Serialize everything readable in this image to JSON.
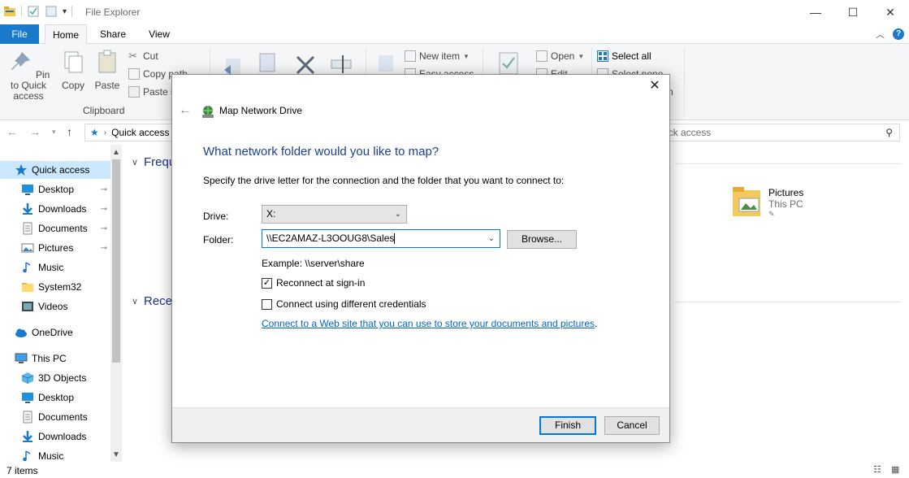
{
  "window": {
    "title": "File Explorer",
    "minimize_glyph": "—",
    "maximize_glyph": "☐",
    "close_glyph": "✕"
  },
  "ribbon_tabs": {
    "file": "File",
    "home": "Home",
    "share": "Share",
    "view": "View"
  },
  "ribbon": {
    "pin_label": "Pin to Quick access",
    "copy_label": "Copy",
    "paste_label": "Paste",
    "cut_label": "Cut",
    "copy_path_label": "Copy path",
    "paste_shortcut_label": "Paste s",
    "clipboard_group": "Clipboard",
    "new_item_label": "New item",
    "easy_access_label": "Easy access",
    "open_label": "Open",
    "edit_label": "Edit",
    "select_all_label": "Select all",
    "select_none_label": "Select none",
    "invert_label": "n"
  },
  "address": {
    "location": "Quick access",
    "search_placeholder": "ick access"
  },
  "navpane": {
    "items": [
      {
        "label": "Quick access",
        "icon": "star-icon",
        "pinned": false
      },
      {
        "label": "Desktop",
        "icon": "desktop-icon",
        "pinned": true
      },
      {
        "label": "Downloads",
        "icon": "download-icon",
        "pinned": true
      },
      {
        "label": "Documents",
        "icon": "document-icon",
        "pinned": true
      },
      {
        "label": "Pictures",
        "icon": "pictures-icon",
        "pinned": true
      },
      {
        "label": "Music",
        "icon": "music-icon",
        "pinned": false
      },
      {
        "label": "System32",
        "icon": "folder-icon",
        "pinned": false
      },
      {
        "label": "Videos",
        "icon": "video-icon",
        "pinned": false
      },
      {
        "label": "OneDrive",
        "icon": "cloud-icon",
        "pinned": false
      },
      {
        "label": "This PC",
        "icon": "computer-icon",
        "pinned": false
      },
      {
        "label": "3D Objects",
        "icon": "cube-icon",
        "pinned": false
      },
      {
        "label": "Desktop",
        "icon": "desktop-icon",
        "pinned": false
      },
      {
        "label": "Documents",
        "icon": "document-icon",
        "pinned": false
      },
      {
        "label": "Downloads",
        "icon": "download-icon",
        "pinned": false
      },
      {
        "label": "Music",
        "icon": "music-icon",
        "pinned": false
      }
    ]
  },
  "content": {
    "frequent_header": "Frequ",
    "recent_header": "Recen",
    "tile_name": "Pictures",
    "tile_location": "This PC"
  },
  "status": {
    "items_count": "7 items"
  },
  "dialog": {
    "title": "Map Network Drive",
    "heading": "What network folder would you like to map?",
    "instruction": "Specify the drive letter for the connection and the folder that you want to connect to:",
    "drive_label": "Drive:",
    "drive_value": "X:",
    "folder_label": "Folder:",
    "folder_value": "\\\\EC2AMAZ-L3OOUG8\\Sales",
    "browse_label": "Browse...",
    "example_text": "Example: \\\\server\\share",
    "reconnect_label": "Reconnect at sign-in",
    "reconnect_checked": true,
    "credentials_label": "Connect using different credentials",
    "credentials_checked": false,
    "link_text": "Connect to a Web site that you can use to store your documents and pictures",
    "link_suffix": ".",
    "finish_label": "Finish",
    "cancel_label": "Cancel"
  },
  "colors": {
    "accent": "#1979ca",
    "heading_blue": "#1b3f93",
    "link_blue": "#0066cc",
    "selection": "#cce8ff"
  }
}
